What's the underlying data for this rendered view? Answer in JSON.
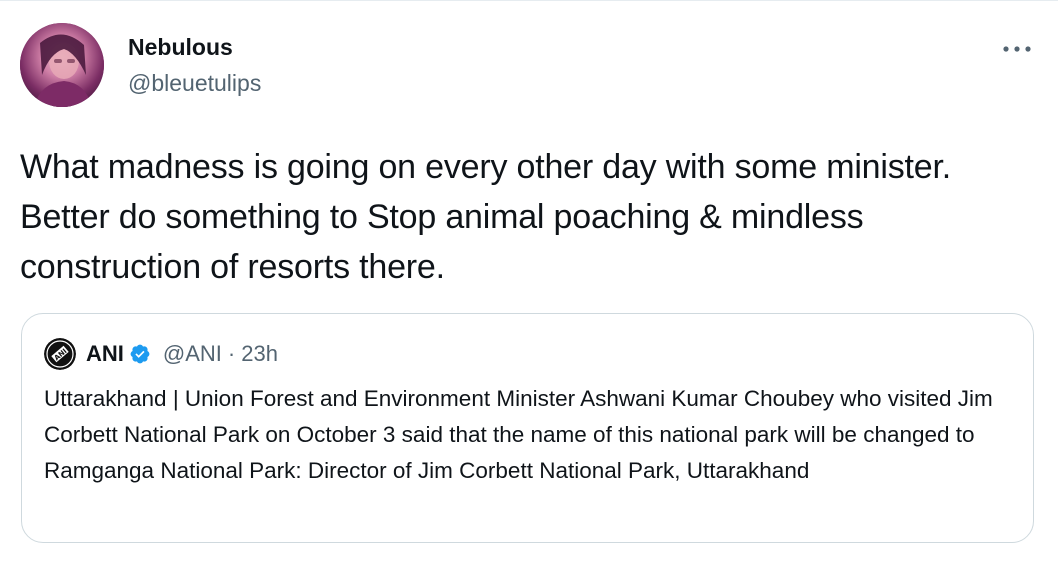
{
  "tweet": {
    "author": {
      "display_name": "Nebulous",
      "handle": "@bleuetulips",
      "avatar_icon": "user-avatar-photo"
    },
    "more_icon": "more-horizontal-icon",
    "text": "What madness is going on every other day with some minister. Better do something to Stop animal poaching & mindless construction of resorts there."
  },
  "quoted_tweet": {
    "author": {
      "display_name": "ANI",
      "handle": "@ANI",
      "avatar_icon": "ani-logo",
      "verified_icon": "verified-badge-icon"
    },
    "separator": "·",
    "time": "23h",
    "text": "Uttarakhand | Union Forest and Environment Minister Ashwani Kumar Choubey who visited Jim Corbett National Park on October 3 said that the name of this national park will be changed to Ramganga National Park: Director of Jim Corbett National Park, Uttarakhand"
  },
  "colors": {
    "text_primary": "#0f1419",
    "text_secondary": "#536471",
    "border": "#cfd9de",
    "verified_blue": "#1d9bf0"
  }
}
